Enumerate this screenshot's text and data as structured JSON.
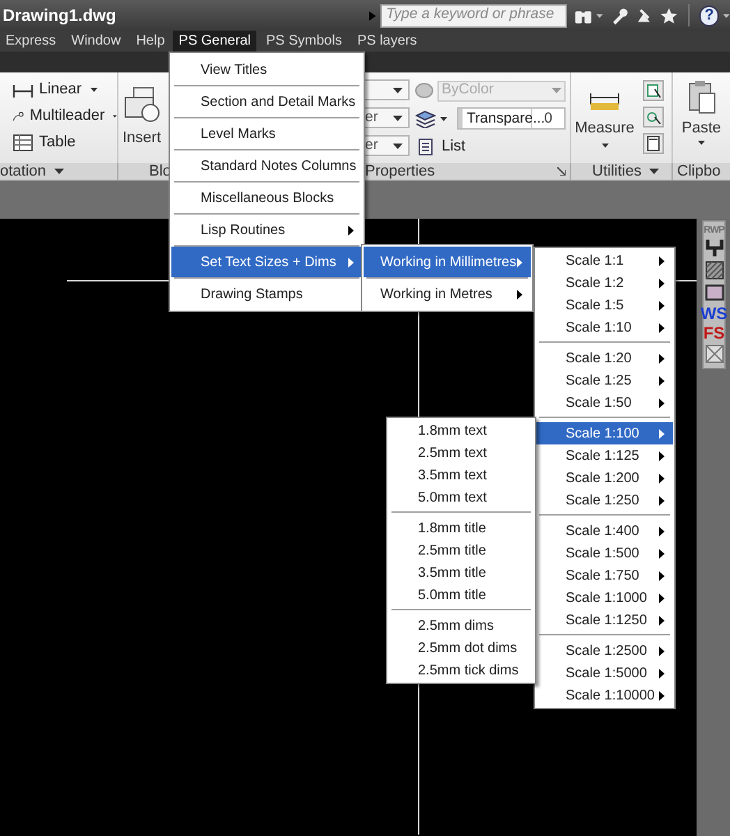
{
  "window": {
    "title": "Drawing1.dwg"
  },
  "search": {
    "placeholder": "Type a keyword or phrase"
  },
  "help_button": {
    "label": "?"
  },
  "menu_bar": [
    {
      "label": "Express",
      "selected": false
    },
    {
      "label": "Window",
      "selected": false
    },
    {
      "label": "Help",
      "selected": false
    },
    {
      "label": "PS General",
      "selected": true
    },
    {
      "label": "PS Symbols",
      "selected": false
    },
    {
      "label": "PS layers",
      "selected": false
    }
  ],
  "ribbon": {
    "annotation": {
      "tools": [
        "Linear",
        "Multileader",
        "Table"
      ],
      "label": "otation"
    },
    "block": {
      "tool": "Insert",
      "label": "Blo"
    },
    "properties": {
      "dropdowns": [
        {
          "kind": "dropdown"
        },
        {
          "kind": "dropdown",
          "value": "er"
        },
        {
          "kind": "dropdown",
          "value": "er"
        }
      ],
      "color": {
        "value": "ByColor",
        "disabled": true
      },
      "transparency": {
        "label": "Transpare...",
        "value": "0"
      },
      "list": "List",
      "label": "Properties"
    },
    "utilities": {
      "tool": "Measure",
      "label": "Utilities"
    },
    "clipboard": {
      "tool": "Paste",
      "label": "Clipbo"
    }
  },
  "menus": [
    {
      "groups": [
        [
          {
            "label": "View Titles",
            "has_submenu": false,
            "selected": false
          }
        ],
        [
          {
            "label": "Section and Detail Marks",
            "has_submenu": false,
            "selected": false
          }
        ],
        [
          {
            "label": "Level Marks",
            "has_submenu": false,
            "selected": false
          }
        ],
        [
          {
            "label": "Standard Notes Columns",
            "has_submenu": false,
            "selected": false
          }
        ],
        [
          {
            "label": "Miscellaneous Blocks",
            "has_submenu": false,
            "selected": false
          }
        ],
        [
          {
            "label": "Lisp Routines",
            "has_submenu": true,
            "selected": false
          }
        ],
        [
          {
            "label": "Set Text Sizes + Dims",
            "has_submenu": true,
            "selected": true
          }
        ],
        [
          {
            "label": "Drawing Stamps",
            "has_submenu": false,
            "selected": false
          }
        ]
      ]
    },
    {
      "groups": [
        [
          {
            "label": "Working in Millimetres",
            "has_submenu": true,
            "selected": true
          }
        ],
        [
          {
            "label": "Working in Metres",
            "has_submenu": true,
            "selected": false
          }
        ]
      ]
    },
    {
      "groups": [
        [
          {
            "label": "Scale 1:1",
            "has_submenu": true,
            "selected": false
          },
          {
            "label": "Scale 1:2",
            "has_submenu": true,
            "selected": false
          },
          {
            "label": "Scale 1:5",
            "has_submenu": true,
            "selected": false
          },
          {
            "label": "Scale 1:10",
            "has_submenu": true,
            "selected": false
          }
        ],
        [
          {
            "label": "Scale 1:20",
            "has_submenu": true,
            "selected": false
          },
          {
            "label": "Scale 1:25",
            "has_submenu": true,
            "selected": false
          },
          {
            "label": "Scale 1:50",
            "has_submenu": true,
            "selected": false
          }
        ],
        [
          {
            "label": "Scale 1:100",
            "has_submenu": true,
            "selected": true
          },
          {
            "label": "Scale 1:125",
            "has_submenu": true,
            "selected": false
          },
          {
            "label": "Scale 1:200",
            "has_submenu": true,
            "selected": false
          },
          {
            "label": "Scale 1:250",
            "has_submenu": true,
            "selected": false
          }
        ],
        [
          {
            "label": "Scale 1:400",
            "has_submenu": true,
            "selected": false
          },
          {
            "label": "Scale 1:500",
            "has_submenu": true,
            "selected": false
          },
          {
            "label": "Scale 1:750",
            "has_submenu": true,
            "selected": false
          },
          {
            "label": "Scale 1:1000",
            "has_submenu": true,
            "selected": false
          },
          {
            "label": "Scale 1:1250",
            "has_submenu": true,
            "selected": false
          }
        ],
        [
          {
            "label": "Scale 1:2500",
            "has_submenu": true,
            "selected": false
          },
          {
            "label": "Scale 1:5000",
            "has_submenu": true,
            "selected": false
          },
          {
            "label": "Scale 1:10000",
            "has_submenu": true,
            "selected": false
          }
        ]
      ]
    },
    {
      "groups": [
        [
          {
            "label": "1.8mm text",
            "has_submenu": false,
            "selected": false
          },
          {
            "label": "2.5mm text",
            "has_submenu": false,
            "selected": false
          },
          {
            "label": "3.5mm text",
            "has_submenu": false,
            "selected": false
          },
          {
            "label": "5.0mm text",
            "has_submenu": false,
            "selected": false
          }
        ],
        [
          {
            "label": "1.8mm title",
            "has_submenu": false,
            "selected": false
          },
          {
            "label": "2.5mm title",
            "has_submenu": false,
            "selected": false
          },
          {
            "label": "3.5mm title",
            "has_submenu": false,
            "selected": false
          },
          {
            "label": "5.0mm title",
            "has_submenu": false,
            "selected": false
          }
        ],
        [
          {
            "label": "2.5mm dims",
            "has_submenu": false,
            "selected": false
          },
          {
            "label": "2.5mm dot dims",
            "has_submenu": false,
            "selected": false
          },
          {
            "label": "2.5mm tick dims",
            "has_submenu": false,
            "selected": false
          }
        ]
      ]
    }
  ],
  "side_toolbar": [
    {
      "kind": "text",
      "label": "RWP",
      "color": "#707070"
    },
    {
      "kind": "fork"
    },
    {
      "kind": "hatch"
    },
    {
      "kind": "frame"
    },
    {
      "kind": "text",
      "label": "WS",
      "color": "#1b3fd0"
    },
    {
      "kind": "text",
      "label": "FS",
      "color": "#c01818"
    },
    {
      "kind": "cross"
    }
  ]
}
